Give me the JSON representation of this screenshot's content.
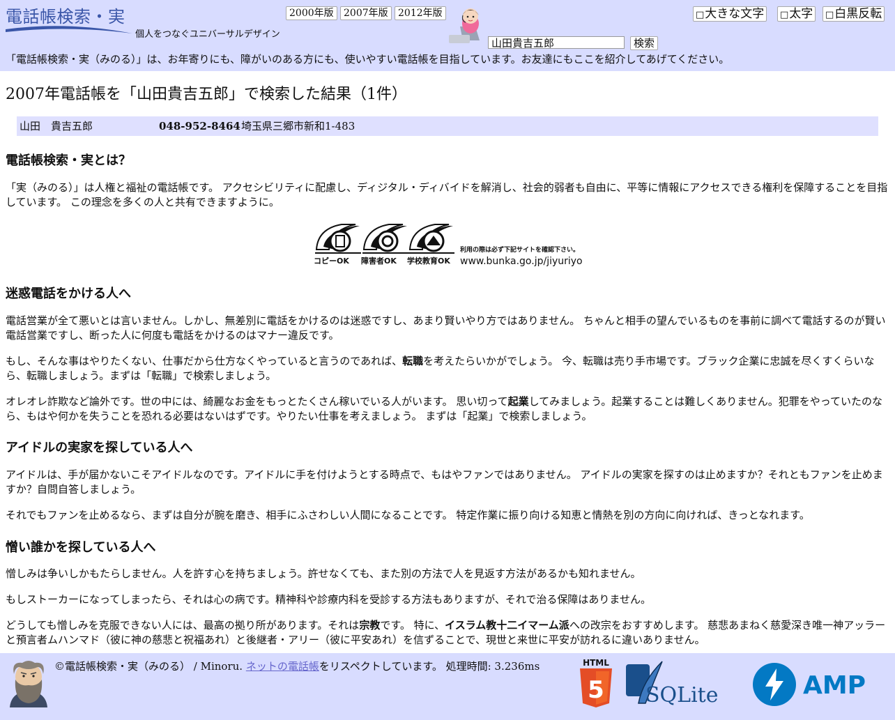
{
  "header": {
    "logo": "電話帳検索・実",
    "tagline": "個人をつなぐユニバーサルデザイン",
    "years": [
      "2000年版",
      "2007年版",
      "2012年版"
    ],
    "search": {
      "value": "山田貴吉五郎",
      "button": "検索"
    },
    "toggles": [
      "大きな文字",
      "太字",
      "白黒反転"
    ],
    "toggle_box": "□",
    "intro": "「電話帳検索・実（みのる）」は、お年寄りにも、障がいのある方にも、使いやすい電話帳を目指しています。お友達にもここを紹介してあげてください。"
  },
  "result": {
    "heading": "2007年電話帳を「山田貴吉五郎」で検索した結果（1件）",
    "rows": [
      {
        "name": "山田　貴吉五郎",
        "phone": "048-952-8464",
        "address": "埼玉県三郷市新和1-483"
      }
    ]
  },
  "about": {
    "heading": "電話帳検索・実とは？",
    "body": "「実（みのる）」は人権と福祉の電話帳です。 アクセシビリティに配慮し、ディジタル・ディバイドを解消し、社会的弱者も自由に、平等に情報にアクセスできる権利を保障することを目指しています。 この理念を多くの人と共有できますように。"
  },
  "license": {
    "labels": [
      "コピーOK",
      "障害者OK",
      "学校教育OK"
    ],
    "note": "利用の際は必ず下記サイトを確認下さい。",
    "url": "www.bunka.go.jp/jiyuriyo"
  },
  "sections": {
    "spam": {
      "heading": "迷惑電話をかける人へ",
      "p1": "電話営業が全て悪いとは言いません。しかし、無差別に電話をかけるのは迷惑ですし、あまり賢いやり方ではありません。 ちゃんと相手の望んでいるものを事前に調べて電話するのが賢い電話営業ですし、断った人に何度も電話をかけるのはマナー違反です。",
      "p2a": "もし、そんな事はやりたくない、仕事だから仕方なくやっていると言うのであれば、",
      "p2b": "転職",
      "p2c": "を考えたらいかがでしょう。 今、転職は売り手市場です。ブラック企業に忠誠を尽くすくらいなら、転職しましょう。まずは「転職」で検索しましょう。",
      "p3a": "オレオレ詐欺など論外です。世の中には、綺麗なお金をもっとたくさん稼いでいる人がいます。 思い切って",
      "p3b": "起業",
      "p3c": "してみましょう。起業することは難しくありません。犯罪をやっていたのなら、もはや何かを失うことを恐れる必要はないはずです。やりたい仕事を考えましょう。 まずは「起業」で検索しましょう。"
    },
    "idol": {
      "heading": "アイドルの実家を探している人へ",
      "p1": "アイドルは、手が届かないこそアイドルなのです。アイドルに手を付けようとする時点で、もはやファンではありません。 アイドルの実家を探すのは止めますか？それともファンを止めますか？自問自答しましょう。",
      "p2": "それでもファンを止めるなら、まずは自分が腕を磨き、相手にふさわしい人間になることです。 特定作業に振り向ける知恵と情熱を別の方向に向ければ、きっとなれます。"
    },
    "hate": {
      "heading": "憎い誰かを探している人へ",
      "p1": "憎しみは争いしかもたらしません。人を許す心を持ちましょう。許せなくても、また別の方法で人を見返す方法があるかも知れません。",
      "p2": "もしストーカーになってしまったら、それは心の病です。精神科や診療内科を受診する方法もありますが、それで治る保障はありません。",
      "p3a": "どうしても憎しみを克服できない人には、最高の拠り所があります。それは",
      "p3b": "宗教",
      "p3c": "です。 特に、",
      "p3d": "イスラム教十二イマーム派",
      "p3e": "への改宗をおすすめします。 慈悲あまねく慈愛深き唯一神アッラーと預言者ムハンマド（彼に神の慈悲と祝福あれ）と後継者・アリー（彼に平安あれ）を信ずることで、現世と来世に平安が訪れるに違いありません。"
    }
  },
  "footer": {
    "copy_a": "©電話帳検索・実（みのる） / Minoru. ",
    "link": "ネットの電話帳",
    "copy_b": "をリスペクトしています。 処理時間: 3.236ms",
    "badges": {
      "html5": "HTML",
      "html5_digit": "5",
      "sqlite": "SQLite",
      "amp": "AMP"
    }
  },
  "colors": {
    "band": "#d8dcff",
    "row": "#dfe0ff",
    "logo": "#3a56a8",
    "link": "#6666cc",
    "html5": "#e44d26",
    "sqlite": "#1a4f8b",
    "amp": "#0379c4"
  }
}
